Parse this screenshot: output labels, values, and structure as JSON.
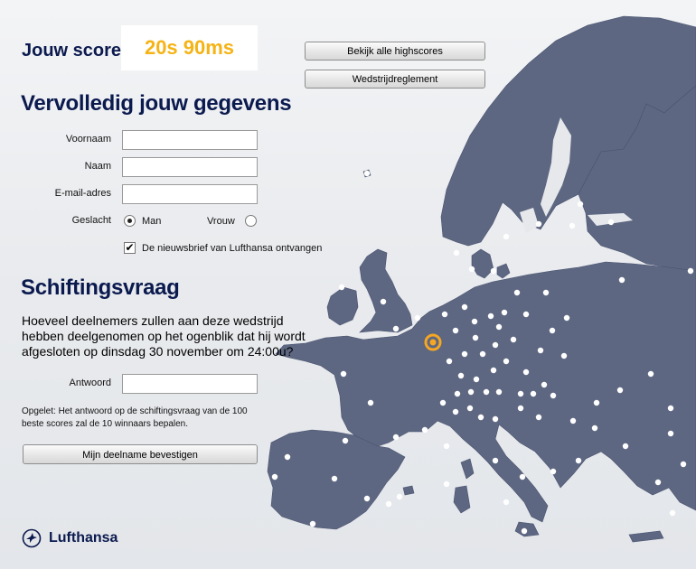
{
  "score": {
    "label": "Jouw score",
    "value": "20s 90ms"
  },
  "top_buttons": {
    "highscores": "Bekijk alle highscores",
    "rules": "Wedstrijdreglement"
  },
  "form": {
    "title": "Vervolledig jouw gegevens",
    "firstname_label": "Voornaam",
    "firstname_value": "",
    "lastname_label": "Naam",
    "lastname_value": "",
    "email_label": "E-mail-adres",
    "email_value": "",
    "gender_label": "Geslacht",
    "gender_male": "Man",
    "gender_female": "Vrouw",
    "gender_selected": "Man",
    "newsletter_label": "De nieuwsbrief van Lufthansa ontvangen",
    "newsletter_checked": true
  },
  "tiebreak": {
    "title": "Schiftingsvraag",
    "question": "Hoeveel deelnemers zullen aan deze wedstrijd hebben deelgenomen op het ogenblik dat hij wordt afgesloten op dinsdag 30 november om 24:00u?",
    "answer_label": "Antwoord",
    "answer_value": "",
    "note": "Opgelet: Het antwoord op de schiftingsvraag van de 100 beste scores zal de 10 winnaars bepalen.",
    "submit_label": "Mijn deelname bevestigen"
  },
  "brand": {
    "name": "Lufthansa"
  },
  "colors": {
    "land": "#5d6781",
    "score": "#f5b315",
    "highlight": "#f5a623",
    "title": "#0b1a4e"
  }
}
